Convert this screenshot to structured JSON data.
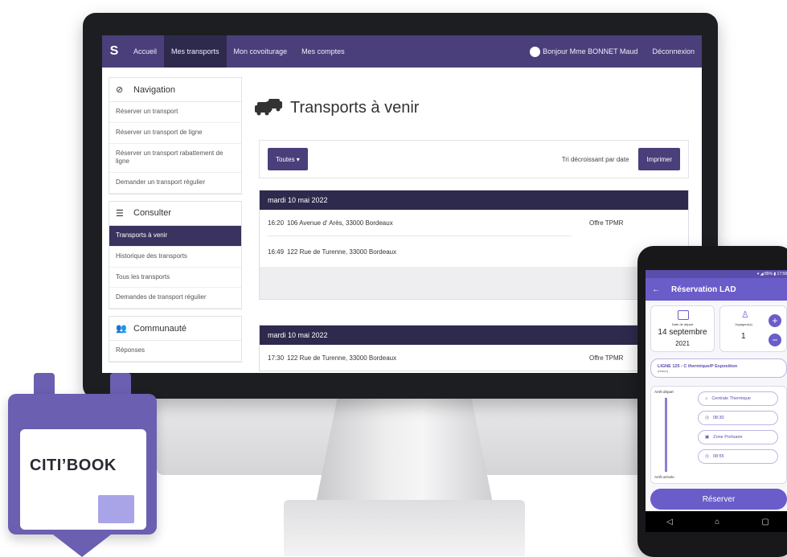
{
  "navbar": {
    "logo": "S",
    "links": [
      "Accueil",
      "Mes transports",
      "Mon covoiturage",
      "Mes comptes"
    ],
    "active_index": 1,
    "greeting": "Bonjour Mme BONNET Maud",
    "logout": "Déconnexion"
  },
  "sidebar": {
    "navigation": {
      "title": "Navigation",
      "items": [
        "Réserver un transport",
        "Réserver un transport de ligne",
        "Réserver un transport rabattement de ligne",
        "Demander un transport régulier"
      ]
    },
    "consulter": {
      "title": "Consulter",
      "items": [
        "Transports à venir",
        "Historique des transports",
        "Tous les transports",
        "Demandes de transport régulier"
      ],
      "active_index": 0
    },
    "communaute": {
      "title": "Communauté",
      "items": [
        "Réponses"
      ]
    }
  },
  "main": {
    "title": "Transports à venir",
    "filter_button": "Toutes ▾",
    "sort_label": "Tri décroissant par date",
    "print_button": "Imprimer",
    "days": [
      {
        "date": "mardi 10 mai 2022",
        "trips": [
          {
            "time": "16:20",
            "address": "106 Avenue d' Arès, 33000 Bordeaux",
            "offer": "Offre TPMR"
          },
          {
            "time": "16:49",
            "address": "122 Rue de Turenne, 33000 Bordeaux",
            "offer": ""
          }
        ]
      },
      {
        "date": "mardi 10 mai 2022",
        "trips": [
          {
            "time": "17:30",
            "address": "122 Rue de Turenne, 33000 Bordeaux",
            "offer": "Offre TPMR"
          }
        ]
      }
    ]
  },
  "badge": {
    "text_light": "CITI’",
    "text_bold": "BOOK"
  },
  "phone": {
    "status": "▾ ◢ 85% ▮ 17:58",
    "header_title": "Réservation LAD",
    "date_label": "Date de départ",
    "date_day": "14 septembre",
    "date_year": "2021",
    "travelers_label": "Voyageur(s)",
    "travelers_count": "1",
    "line_label": "LIGNE 125 - C thermique/P Exposition",
    "line_sub": "(retour)",
    "depart_label": "Arrêt départ",
    "arrive_label": "Arrêt arrivée",
    "stop_from": "Centrale Thermique",
    "time_from": "08:30",
    "stop_to": "Zone Portuaire",
    "time_to": "08:55",
    "reserve_button": "Réserver",
    "nav_back": "◁",
    "nav_home": "⌂",
    "nav_recent": "▢"
  },
  "colors": {
    "primary": "#4a3f7a",
    "dark": "#2e2a4d",
    "accent": "#6a5cc9"
  }
}
